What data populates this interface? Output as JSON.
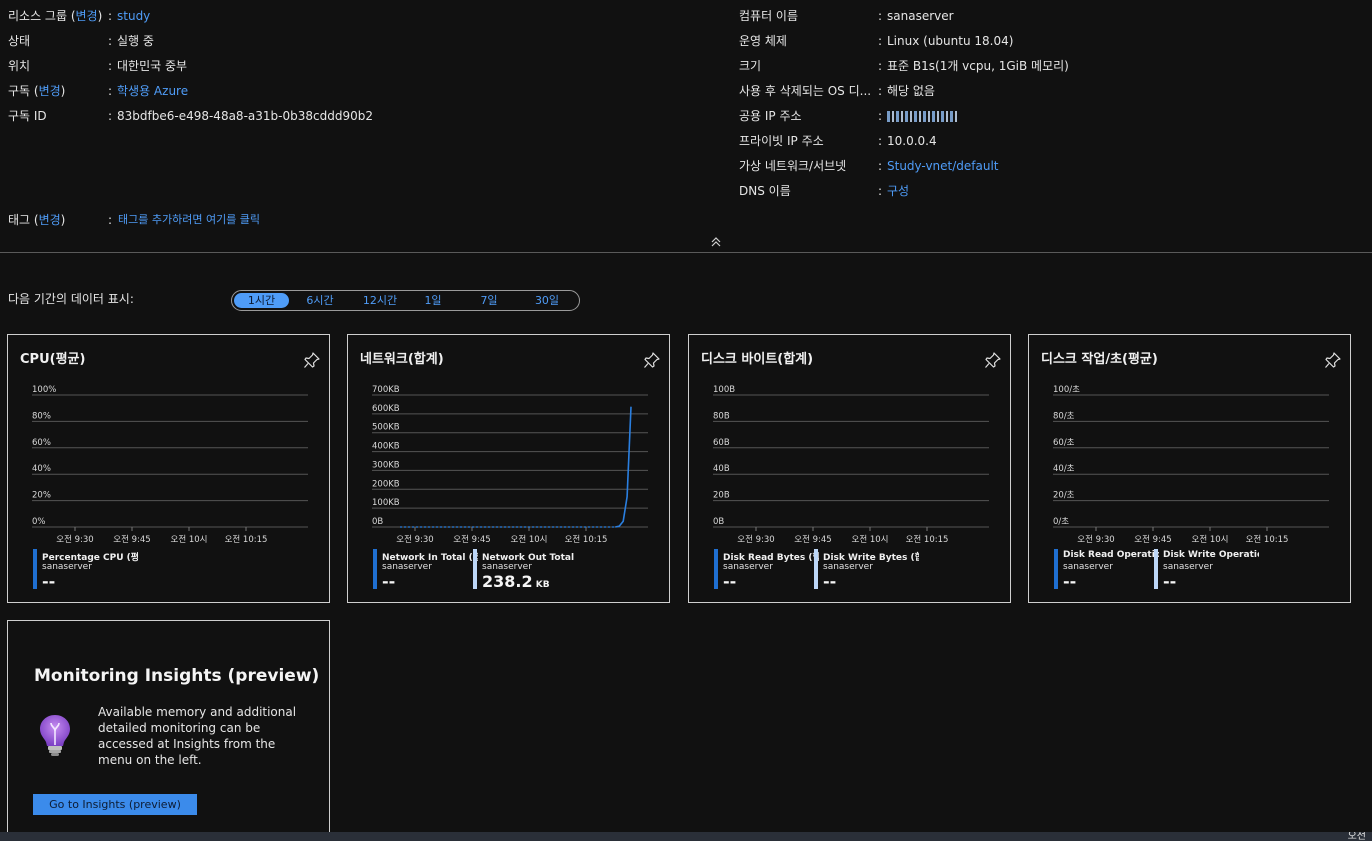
{
  "essentials_left": [
    {
      "label": "리소스 그룹 (변경)",
      "value": "study",
      "value_link": true
    },
    {
      "label": "상태",
      "value": "실행 중",
      "value_link": false
    },
    {
      "label": "위치",
      "value": "대한민국 중부",
      "value_link": false
    },
    {
      "label": "구독 (변경)",
      "value": "학생용 Azure",
      "value_link": true
    },
    {
      "label": "구독 ID",
      "value": "83bdfbe6-e498-48a8-a31b-0b38cddd90b2",
      "value_link": false
    }
  ],
  "essentials_right": [
    {
      "label": "컴퓨터 이름",
      "value": "sanaserver",
      "value_link": false
    },
    {
      "label": "운영 체제",
      "value": "Linux (ubuntu 18.04)",
      "value_link": false
    },
    {
      "label": "크기",
      "value": "표준 B1s(1개 vcpu, 1GiB 메모리)",
      "value_link": false
    },
    {
      "label": "사용 후 삭제되는 OS 디...",
      "value": "해당 없음",
      "value_link": false
    },
    {
      "label": "공용 IP 주소",
      "value": "",
      "value_link": true
    },
    {
      "label": "프라이빗 IP 주소",
      "value": "10.0.0.4",
      "value_link": false
    },
    {
      "label": "가상 네트워크/서브넷",
      "value": "Study-vnet/default",
      "value_link": true
    },
    {
      "label": "DNS 이름",
      "value": "구성",
      "value_link": true
    }
  ],
  "tags": {
    "label_prefix": "태그 (",
    "label_link": "변경",
    "label_suffix": ")",
    "value": "태그를 추가하려면 여기를 클릭"
  },
  "rg_label": {
    "prefix": "리소스 그룹 (",
    "link": "변경",
    "suffix": ")"
  },
  "sub_label": {
    "prefix": "구독 (",
    "link": "변경",
    "suffix": ")"
  },
  "time_range": {
    "label": "다음 기간의 데이터 표시:",
    "options": [
      "1시간",
      "6시간",
      "12시간",
      "1일",
      "7일",
      "30일"
    ],
    "selected": "1시간"
  },
  "x_ticks": [
    "오전 9:30",
    "오전 9:45",
    "오전 10시",
    "오전 10:15"
  ],
  "charts": [
    {
      "title": "CPU(평균)",
      "y_ticks": [
        "100%",
        "80%",
        "60%",
        "40%",
        "20%",
        "0%"
      ],
      "legend": [
        {
          "name": "Percentage CPU (평균)",
          "sub": "sanaserver",
          "value": "--",
          "unit": "",
          "color": "#1f6fd1"
        }
      ]
    },
    {
      "title": "네트워크(합계)",
      "y_ticks": [
        "700KB",
        "600KB",
        "500KB",
        "400KB",
        "300KB",
        "200KB",
        "100KB",
        "0B"
      ],
      "legend": [
        {
          "name": "Network In Total (합계)",
          "sub": "sanaserver",
          "value": "--",
          "unit": "",
          "color": "#1f6fd1"
        },
        {
          "name": "Network Out Total (합계)",
          "sub": "sanaserver",
          "value": "238.2",
          "unit": "KB",
          "color": "#bcd6f7"
        }
      ]
    },
    {
      "title": "디스크 바이트(합계)",
      "y_ticks": [
        "100B",
        "80B",
        "60B",
        "40B",
        "20B",
        "0B"
      ],
      "legend": [
        {
          "name": "Disk Read Bytes (합계)",
          "sub": "sanaserver",
          "value": "--",
          "unit": "",
          "color": "#1f6fd1"
        },
        {
          "name": "Disk Write Bytes (합계)",
          "sub": "sanaserver",
          "value": "--",
          "unit": "",
          "color": "#bcd6f7"
        }
      ]
    },
    {
      "title": "디스크 작업/초(평균)",
      "y_ticks": [
        "100/초",
        "80/초",
        "60/초",
        "40/초",
        "20/초",
        "0/초"
      ],
      "legend": [
        {
          "name": "Disk Read Operations...",
          "sub": "sanaserver",
          "value": "--",
          "unit": "",
          "color": "#1f6fd1"
        },
        {
          "name": "Disk Write Operation...",
          "sub": "sanaserver",
          "value": "--",
          "unit": "",
          "color": "#bcd6f7"
        }
      ]
    }
  ],
  "chart_data": [
    {
      "type": "line",
      "title": "CPU(평균)",
      "x": [
        "오전 9:30",
        "오전 9:45",
        "오전 10시",
        "오전 10:15"
      ],
      "ylim": [
        0,
        100
      ],
      "series": [
        {
          "name": "Percentage CPU (평균)",
          "values": []
        }
      ]
    },
    {
      "type": "line",
      "title": "네트워크(합계)",
      "x": [
        "오전 9:30",
        "오전 9:45",
        "오전 10시",
        "오전 10:15"
      ],
      "ylim": [
        0,
        700
      ],
      "series": [
        {
          "name": "Network In Total (합계)",
          "values": []
        },
        {
          "name": "Network Out Total (합계)",
          "values": [
            0,
            0,
            0,
            0,
            0,
            0,
            0,
            0,
            0,
            0,
            0,
            0,
            0,
            0,
            0,
            0,
            0,
            0,
            0,
            0,
            0,
            0,
            0,
            0,
            0,
            0,
            0,
            0,
            0,
            0,
            0,
            0,
            0,
            0,
            0,
            0,
            0,
            0,
            0,
            0,
            0,
            0,
            0,
            0,
            0,
            0,
            0,
            0,
            0,
            0,
            0,
            0,
            0,
            0,
            0,
            0,
            5,
            30,
            160,
            638
          ]
        }
      ]
    },
    {
      "type": "line",
      "title": "디스크 바이트(합계)",
      "x": [
        "오전 9:30",
        "오전 9:45",
        "오전 10시",
        "오전 10:15"
      ],
      "ylim": [
        0,
        100
      ],
      "series": [
        {
          "name": "Disk Read Bytes (합계)",
          "values": []
        },
        {
          "name": "Disk Write Bytes (합계)",
          "values": []
        }
      ]
    },
    {
      "type": "line",
      "title": "디스크 작업/초(평균)",
      "x": [
        "오전 9:30",
        "오전 9:45",
        "오전 10시",
        "오전 10:15"
      ],
      "ylim": [
        0,
        100
      ],
      "series": [
        {
          "name": "Disk Read Operations...",
          "values": []
        },
        {
          "name": "Disk Write Operation...",
          "values": []
        }
      ]
    }
  ],
  "insights": {
    "title": "Monitoring Insights (preview)",
    "text": "Available memory and additional detailed monitoring can be accessed at Insights from the menu on the left.",
    "button": "Go to Insights (preview)"
  },
  "footer_text": "오전",
  "colors": {
    "link": "#4f9cf7",
    "series_primary": "#1f6fd1",
    "series_secondary": "#bcd6f7",
    "border": "#cfcfcf"
  }
}
